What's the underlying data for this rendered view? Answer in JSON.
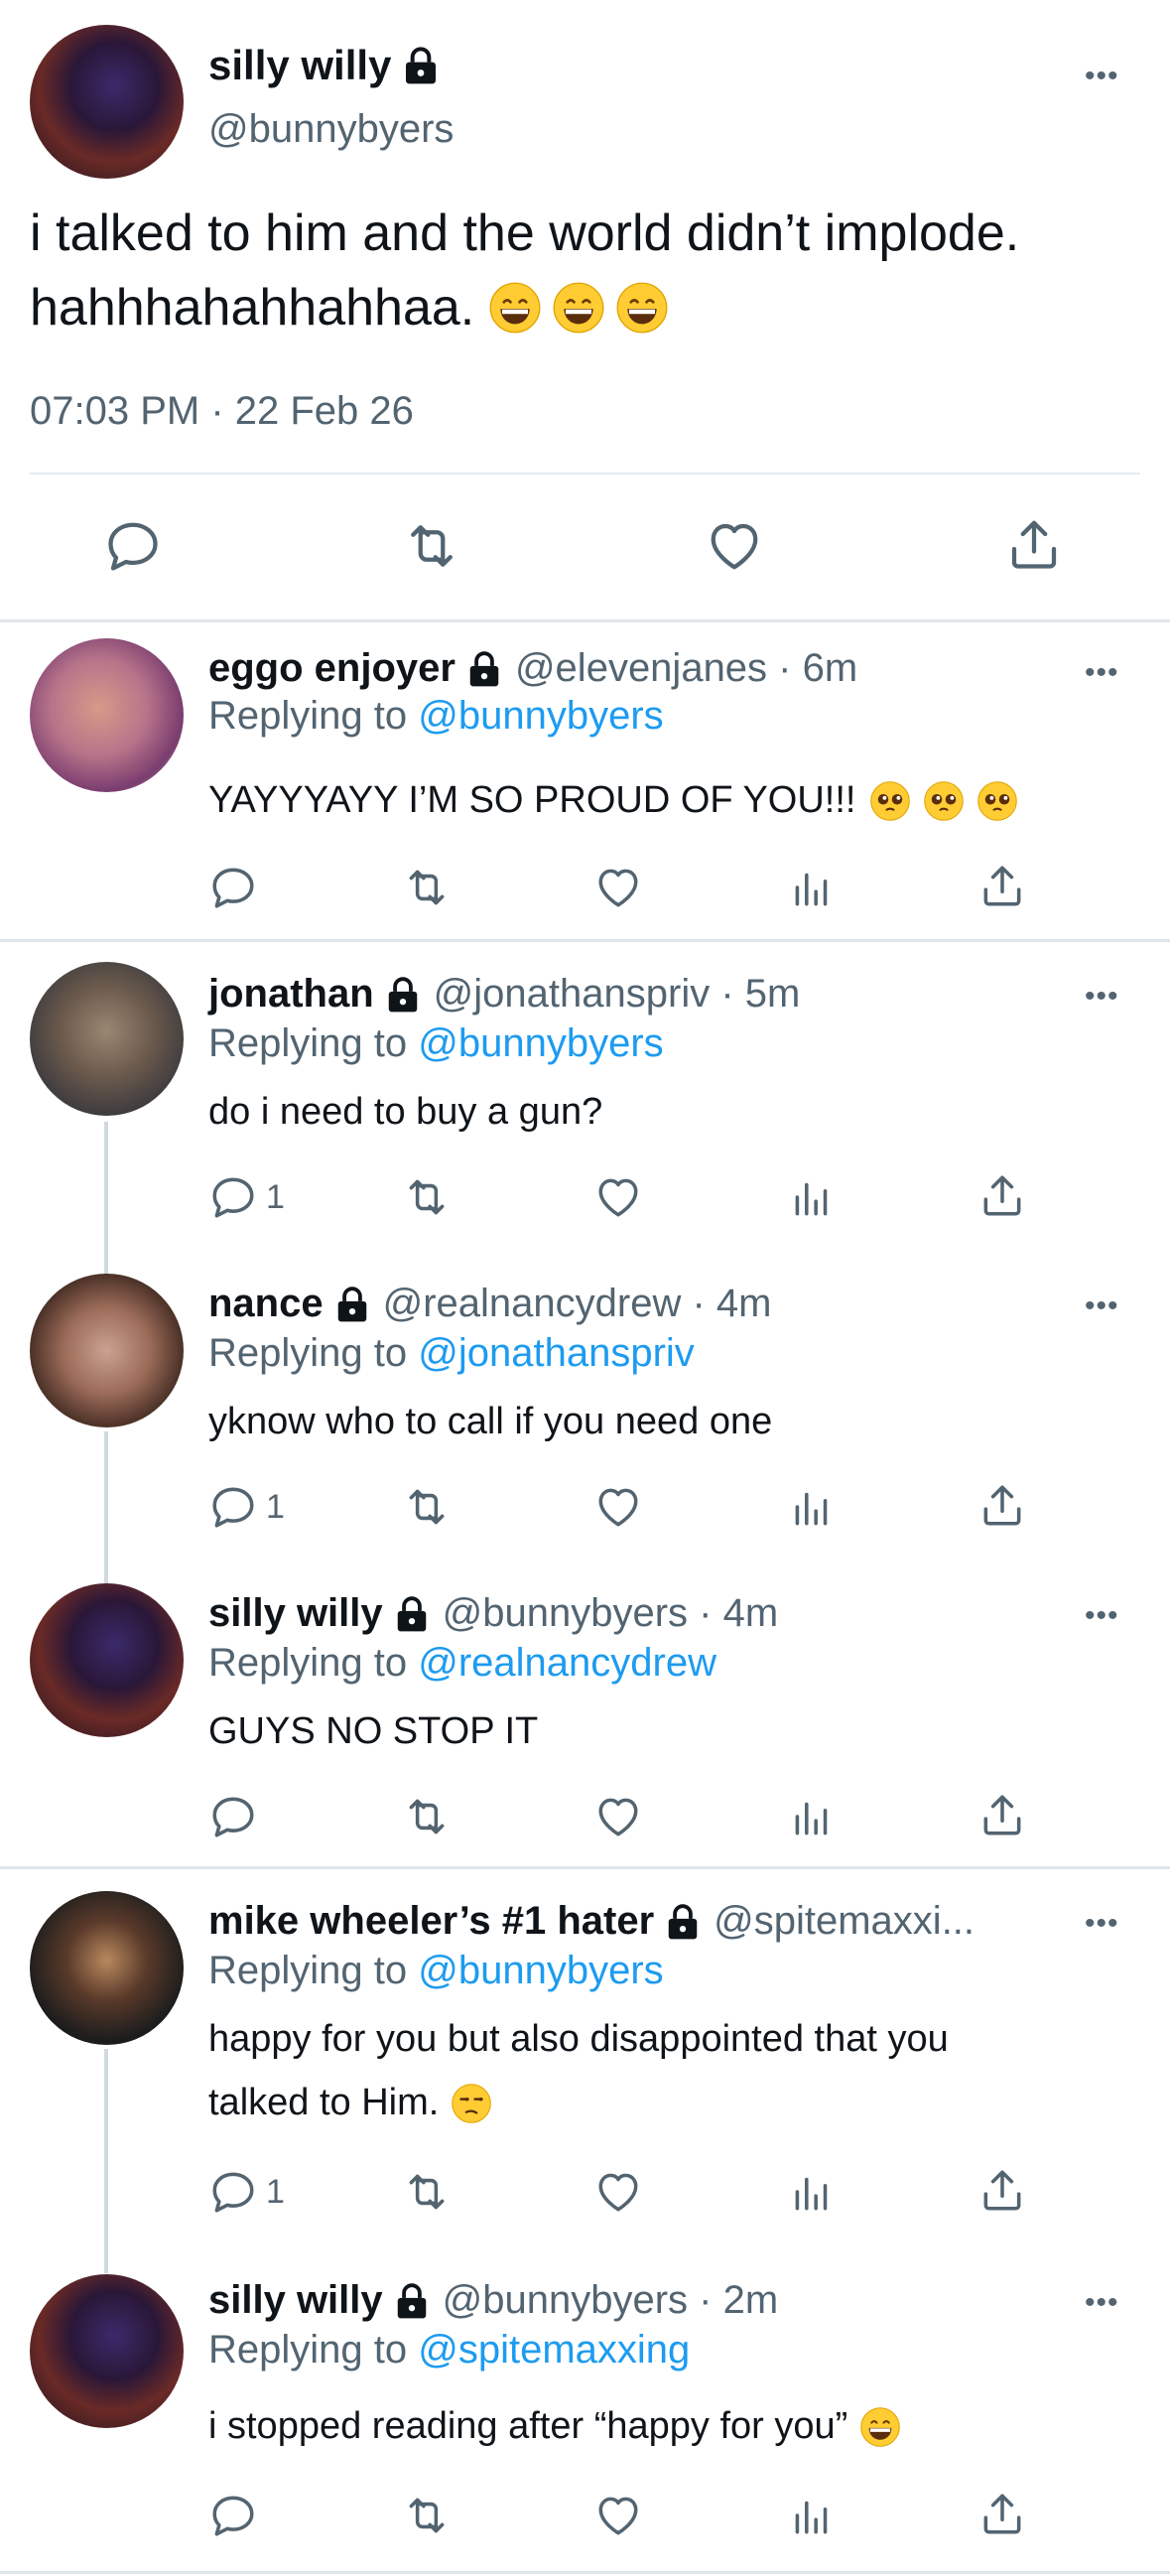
{
  "main_tweet": {
    "display_name": "silly willy",
    "handle": "@bunnybyers",
    "text_line1": "i talked to him and the world didn’t implode.",
    "text_line2": "hahhhahahhahhaa.",
    "timestamp": "07:03 PM · 22 Feb 26",
    "more_label": "•••"
  },
  "replies": [
    {
      "display_name": "eggo enjoyer",
      "handle_time": "@elevenjanes · 6m",
      "replying_prefix": "Replying to",
      "replying_to": "@bunnybyers",
      "text": "YAYYYAYY I’M SO PROUD OF YOU!!!",
      "reply_count": ""
    },
    {
      "display_name": "jonathan",
      "handle_time": "@jonathanspriv · 5m",
      "replying_prefix": "Replying to",
      "replying_to": "@bunnybyers",
      "text": "do i need to buy a gun?",
      "reply_count": "1"
    },
    {
      "display_name": "nance",
      "handle_time": "@realnancydrew · 4m",
      "replying_prefix": "Replying to",
      "replying_to": "@jonathanspriv",
      "text": "yknow who to call if you need one",
      "reply_count": "1"
    },
    {
      "display_name": "silly willy",
      "handle_time": "@bunnybyers · 4m",
      "replying_prefix": "Replying to",
      "replying_to": "@realnancydrew",
      "text": "GUYS NO STOP IT",
      "reply_count": ""
    },
    {
      "display_name": "mike wheeler’s #1 hater",
      "handle_time": "@spitemaxxi...",
      "replying_prefix": "Replying to",
      "replying_to": "@bunnybyers",
      "text_line1": "happy for you but also disappointed that you",
      "text_line2": "talked to Him.",
      "reply_count": "1"
    },
    {
      "display_name": "silly willy",
      "handle_time": "@bunnybyers · 2m",
      "replying_prefix": "Replying to",
      "replying_to": "@spitemaxxing",
      "text": "i stopped reading after “happy for you”",
      "reply_count": ""
    }
  ],
  "colors": {
    "accent": "#1d9bf0",
    "secondary_text": "#536471",
    "primary_text": "#0f1419"
  },
  "icons": [
    "lock-icon",
    "more-icon",
    "reply-icon",
    "retweet-icon",
    "like-icon",
    "analytics-icon",
    "share-icon",
    "grinning-emoji",
    "pleading-emoji",
    "unamused-emoji"
  ]
}
